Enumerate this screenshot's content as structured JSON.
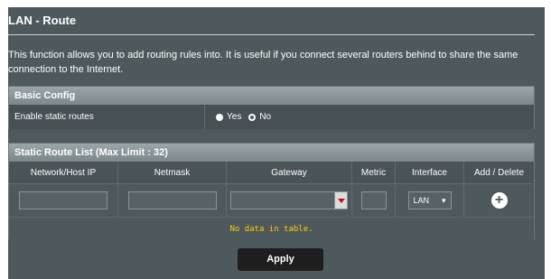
{
  "header": {
    "title": "LAN - Route"
  },
  "description": "This function allows you to add routing rules into. It is useful if you connect several routers behind to share the same connection to the Internet.",
  "basic_config": {
    "heading": "Basic Config",
    "enable_label": "Enable static routes",
    "options": [
      {
        "label": "Yes",
        "selected": false
      },
      {
        "label": "No",
        "selected": true
      }
    ]
  },
  "route_list": {
    "heading": "Static Route List (Max Limit : 32)",
    "columns": [
      "Network/Host IP",
      "Netmask",
      "Gateway",
      "Metric",
      "Interface",
      "Add / Delete"
    ],
    "inputs": {
      "network_ip": "",
      "netmask": "",
      "gateway": "",
      "metric": "",
      "interface": "LAN"
    },
    "empty_message": "No data in table."
  },
  "actions": {
    "apply": "Apply"
  },
  "icons": {
    "add": "plus-circle-icon",
    "dropdown": "caret-down-icon"
  }
}
